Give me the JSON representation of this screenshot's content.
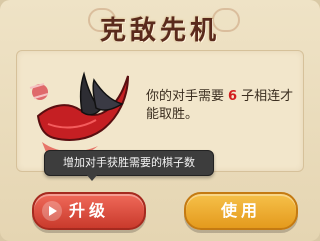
{
  "dialog": {
    "title": "克敌先机"
  },
  "item": {
    "icon": "crimson-blade-icon",
    "desc_prefix": "你的对手需要",
    "desc_number": "6",
    "desc_suffix": "子相连才能取胜。"
  },
  "tooltip": {
    "text": "增加对手获胜需要的棋子数"
  },
  "buttons": {
    "upgrade_label": "升级",
    "use_label": "使用"
  },
  "colors": {
    "accent_red": "#d21e1e",
    "upgrade_button": "#c93a2c",
    "use_button": "#e49a1d"
  }
}
